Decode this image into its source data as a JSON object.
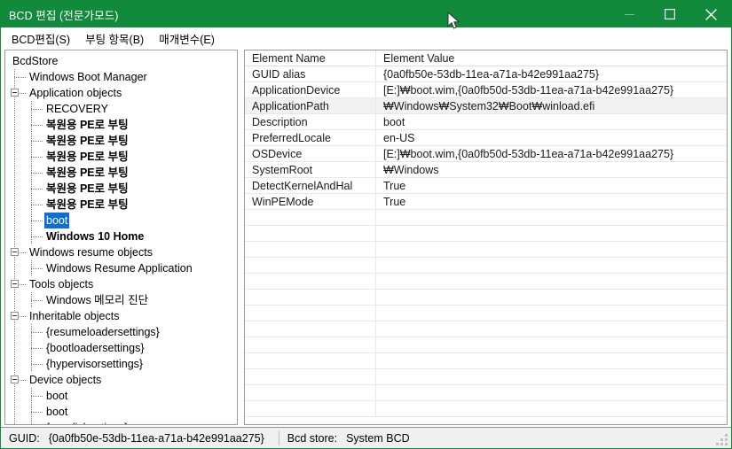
{
  "window": {
    "title": "BCD 편집 (전문가모드)",
    "title_bar_color": "#128a3c",
    "minimize_label": "—",
    "maximize_label": "□",
    "close_label": "✕"
  },
  "menubar": {
    "items": [
      {
        "label": "BCD편집(S)"
      },
      {
        "label": "부팅 항목(B)"
      },
      {
        "label": "매개변수(E)"
      }
    ]
  },
  "tree": {
    "selection_color": "#0b6fd3",
    "nodes": [
      {
        "label": "BcdStore",
        "depth": 0,
        "expander": false,
        "bold": false,
        "selected": false
      },
      {
        "label": "Windows Boot Manager",
        "depth": 1,
        "expander": false,
        "bold": false,
        "selected": false
      },
      {
        "label": "Application objects",
        "depth": 1,
        "expander": true,
        "bold": false,
        "selected": false
      },
      {
        "label": "RECOVERY",
        "depth": 2,
        "expander": false,
        "bold": false,
        "selected": false
      },
      {
        "label": "복원용 PE로 부팅",
        "depth": 2,
        "expander": false,
        "bold": true,
        "selected": false
      },
      {
        "label": "복원용 PE로 부팅",
        "depth": 2,
        "expander": false,
        "bold": true,
        "selected": false
      },
      {
        "label": "복원용 PE로 부팅",
        "depth": 2,
        "expander": false,
        "bold": true,
        "selected": false
      },
      {
        "label": "복원용 PE로 부팅",
        "depth": 2,
        "expander": false,
        "bold": true,
        "selected": false
      },
      {
        "label": "복원용 PE로 부팅",
        "depth": 2,
        "expander": false,
        "bold": true,
        "selected": false
      },
      {
        "label": "복원용 PE로 부팅",
        "depth": 2,
        "expander": false,
        "bold": true,
        "selected": false
      },
      {
        "label": "boot",
        "depth": 2,
        "expander": false,
        "bold": false,
        "selected": true
      },
      {
        "label": "Windows 10 Home",
        "depth": 2,
        "expander": false,
        "bold": true,
        "selected": false
      },
      {
        "label": "Windows resume objects",
        "depth": 1,
        "expander": true,
        "bold": false,
        "selected": false
      },
      {
        "label": "Windows Resume Application",
        "depth": 2,
        "expander": false,
        "bold": false,
        "selected": false
      },
      {
        "label": "Tools objects",
        "depth": 1,
        "expander": true,
        "bold": false,
        "selected": false
      },
      {
        "label": "Windows 메모리 진단",
        "depth": 2,
        "expander": false,
        "bold": false,
        "selected": false
      },
      {
        "label": "Inheritable objects",
        "depth": 1,
        "expander": true,
        "bold": false,
        "selected": false
      },
      {
        "label": "{resumeloadersettings}",
        "depth": 2,
        "expander": false,
        "bold": false,
        "selected": false
      },
      {
        "label": "{bootloadersettings}",
        "depth": 2,
        "expander": false,
        "bold": false,
        "selected": false
      },
      {
        "label": "{hypervisorsettings}",
        "depth": 2,
        "expander": false,
        "bold": false,
        "selected": false
      },
      {
        "label": "Device objects",
        "depth": 1,
        "expander": true,
        "bold": false,
        "selected": false
      },
      {
        "label": "boot",
        "depth": 2,
        "expander": false,
        "bold": false,
        "selected": false
      },
      {
        "label": "boot",
        "depth": 2,
        "expander": false,
        "bold": false,
        "selected": false
      },
      {
        "label": "{ramdiskoptions}",
        "depth": 2,
        "expander": false,
        "bold": false,
        "selected": false
      }
    ]
  },
  "grid": {
    "columns": [
      {
        "label": "Element Name"
      },
      {
        "label": "Element Value"
      }
    ],
    "rows": [
      {
        "name": "GUID alias",
        "value": "{0a0fb50e-53db-11ea-a71a-b42e991aa275}",
        "highlight": false
      },
      {
        "name": "ApplicationDevice",
        "value": "[E:]₩boot.wim,{0a0fb50d-53db-11ea-a71a-b42e991aa275}",
        "highlight": false
      },
      {
        "name": "ApplicationPath",
        "value": "₩Windows₩System32₩Boot₩winload.efi",
        "highlight": true
      },
      {
        "name": "Description",
        "value": "boot",
        "highlight": false
      },
      {
        "name": "PreferredLocale",
        "value": "en-US",
        "highlight": false
      },
      {
        "name": "OSDevice",
        "value": "[E:]₩boot.wim,{0a0fb50d-53db-11ea-a71a-b42e991aa275}",
        "highlight": false
      },
      {
        "name": "SystemRoot",
        "value": "₩Windows",
        "highlight": false
      },
      {
        "name": "DetectKernelAndHal",
        "value": "True",
        "highlight": false
      },
      {
        "name": "WinPEMode",
        "value": "True",
        "highlight": false
      }
    ],
    "empty_row_count": 13
  },
  "statusbar": {
    "guid_label": "GUID:",
    "guid_value": "{0a0fb50e-53db-11ea-a71a-b42e991aa275}",
    "store_label": "Bcd store:",
    "store_value": "System BCD"
  }
}
